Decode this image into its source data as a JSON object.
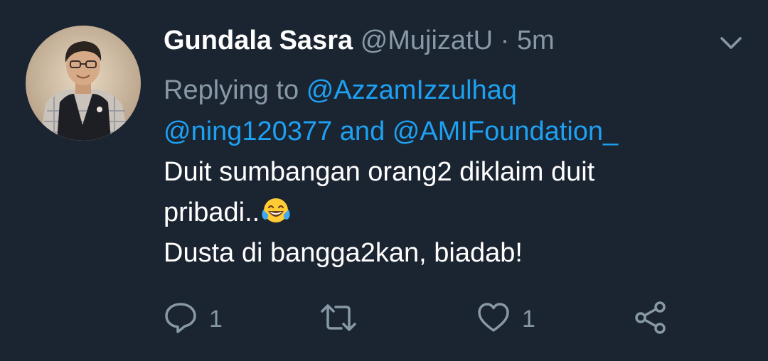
{
  "tweet": {
    "author_name": "Gundala Sasra",
    "author_handle": "@MujizatU",
    "separator": "·",
    "timestamp": "5m",
    "replying_prefix": "Replying to",
    "mention_1": "@AzzamIzzulhaq",
    "mention_2": "@ning120377",
    "and_text": "and",
    "mention_3": "@AMIFoundation_",
    "text_line_1": "Duit sumbangan orang2 diklaim duit",
    "text_line_2": "pribadi..",
    "emoji_name": "face-with-tears-of-joy",
    "text_line_3": "Dusta di bangga2kan, biadab!"
  },
  "actions": {
    "reply_count": "1",
    "retweet_count": "",
    "like_count": "1"
  },
  "icons": {
    "menu": "chevron-down-icon",
    "reply": "reply-icon",
    "retweet": "retweet-icon",
    "like": "heart-icon",
    "share": "share-icon"
  },
  "colors": {
    "background": "#1b2431",
    "primary_text": "#ffffff",
    "secondary_text": "#8899a6",
    "link": "#1da1f2"
  }
}
